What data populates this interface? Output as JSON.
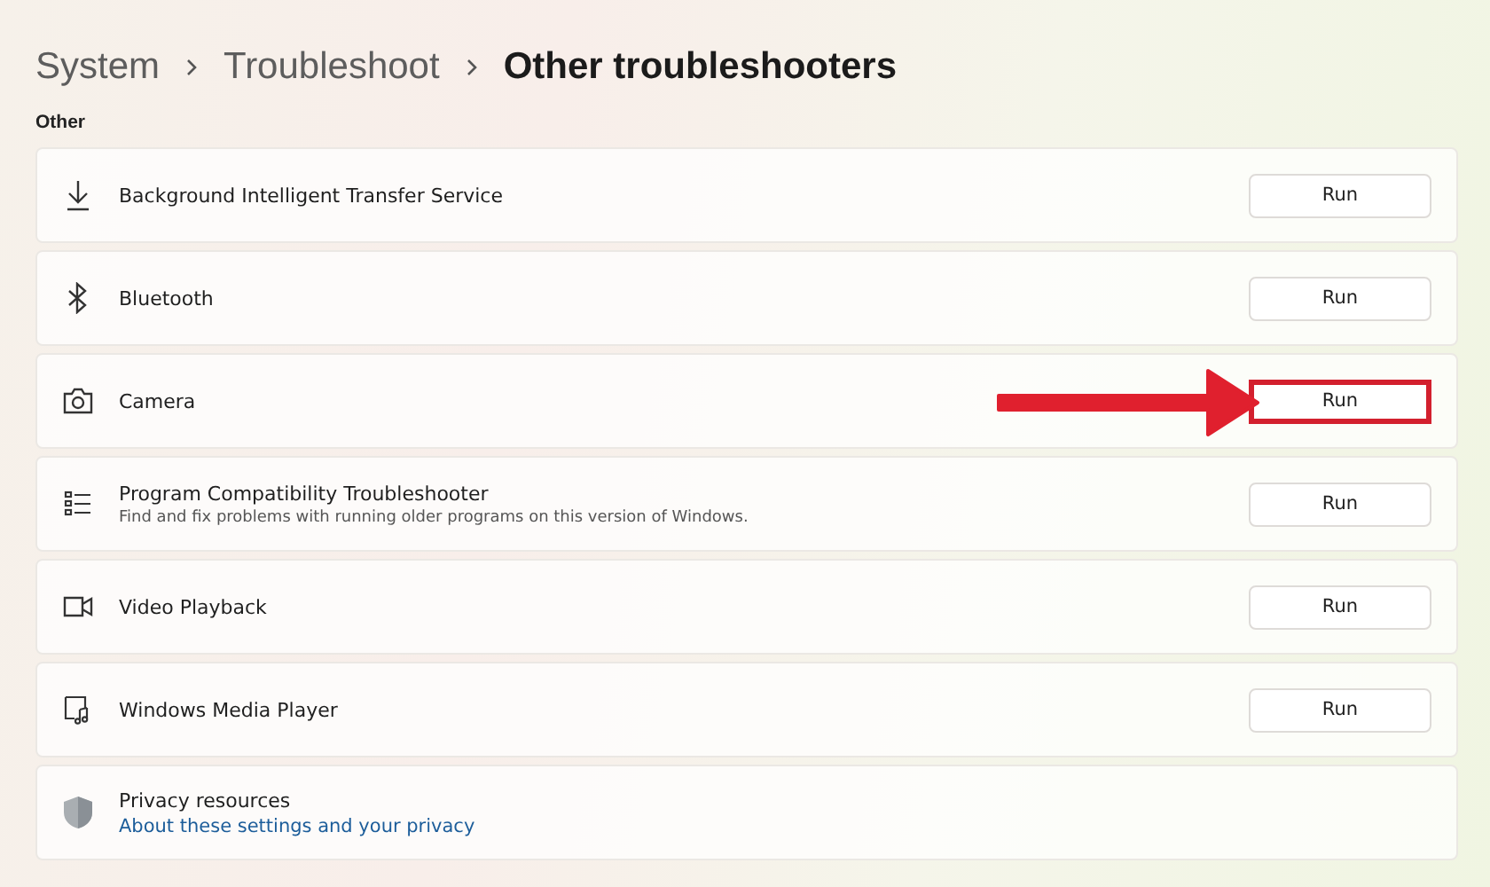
{
  "breadcrumb": [
    {
      "label": "System",
      "current": false
    },
    {
      "label": "Troubleshoot",
      "current": false
    },
    {
      "label": "Other troubleshooters",
      "current": true
    }
  ],
  "section_title": "Other",
  "items": [
    {
      "kind": "run",
      "title": "Background Intelligent Transfer Service",
      "button": "Run",
      "highlighted": false
    },
    {
      "kind": "run",
      "title": "Bluetooth",
      "button": "Run",
      "highlighted": false
    },
    {
      "kind": "run",
      "title": "Camera",
      "button": "Run",
      "highlighted": true
    },
    {
      "kind": "run",
      "title": "Program Compatibility Troubleshooter",
      "description": "Find and fix problems with running older programs on this version of Windows.",
      "button": "Run",
      "highlighted": false
    },
    {
      "kind": "run",
      "title": "Video Playback",
      "button": "Run",
      "highlighted": false
    },
    {
      "kind": "run",
      "title": "Windows Media Player",
      "button": "Run",
      "highlighted": false
    },
    {
      "kind": "link",
      "title": "Privacy resources",
      "link": "About these settings and your privacy"
    }
  ]
}
